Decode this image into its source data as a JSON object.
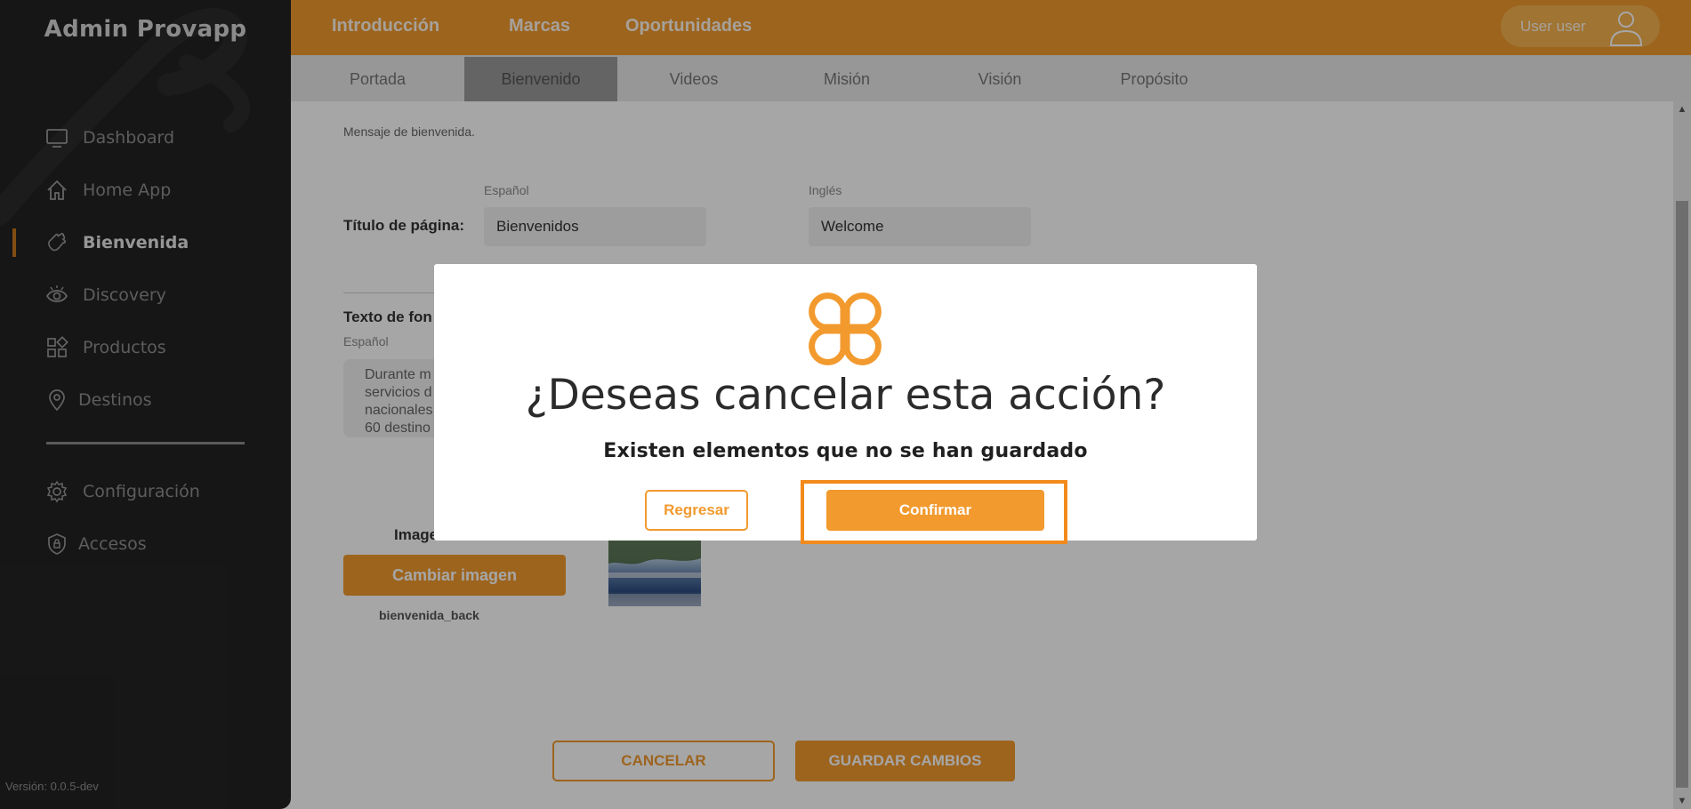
{
  "sidebar": {
    "brand": "Admin Provapp",
    "items": [
      {
        "label": "Dashboard",
        "icon": "monitor-icon"
      },
      {
        "label": "Home App",
        "icon": "home-icon"
      },
      {
        "label": "Bienvenida",
        "icon": "wave-hand-icon",
        "active": true
      },
      {
        "label": "Discovery",
        "icon": "eye-icon"
      },
      {
        "label": "Productos",
        "icon": "grid-icon"
      },
      {
        "label": "Destinos",
        "icon": "map-pin-icon"
      },
      {
        "label": "Configuración",
        "icon": "gear-icon"
      },
      {
        "label": "Accesos",
        "icon": "shield-lock-icon"
      }
    ],
    "version": "Versión: 0.0.5-dev"
  },
  "topbar": {
    "nav": [
      "Introducción",
      "Marcas",
      "Oportunidades"
    ],
    "user": "User user"
  },
  "subtabs": [
    "Portada",
    "Bienvenido",
    "Videos",
    "Misión",
    "Visión",
    "Propósito"
  ],
  "active_subtab": "Bienvenido",
  "content": {
    "section_label": "Mensaje de bienvenida.",
    "lang_es": "Español",
    "lang_en": "Inglés",
    "page_title_label": "Título de página:",
    "page_title_es": "Bienvenidos",
    "page_title_en": "Welcome",
    "bg_text_label": "Texto de fon",
    "bg_text_lang": "Español",
    "bg_text_lines": [
      "Durante m",
      "servicios d",
      "nacionales",
      "60 destino"
    ],
    "bg_image_label": "Imagen de fondo",
    "change_image_button": "Cambiar imagen",
    "image_filename": "bienvenida_back",
    "cancel_button": "CANCELAR",
    "save_button": "GUARDAR CAMBIOS"
  },
  "modal": {
    "title": "¿Deseas cancelar esta acción?",
    "subtitle": "Existen elementos que no se han guardado",
    "back_button": "Regresar",
    "confirm_button": "Confirmar"
  },
  "colors": {
    "accent": "#f29a2e",
    "sidebar_bg": "#232323",
    "highlight_frame": "#f28a1c"
  }
}
